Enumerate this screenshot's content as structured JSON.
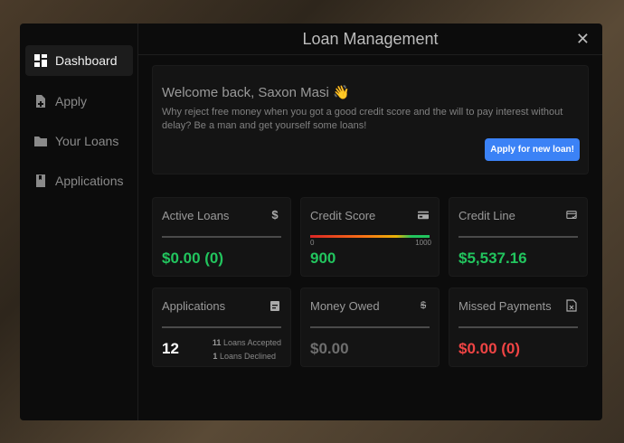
{
  "title": "Loan Management",
  "close": "✕",
  "sidebar": {
    "items": [
      {
        "label": "Dashboard",
        "icon": "dashboard-icon"
      },
      {
        "label": "Apply",
        "icon": "file-plus-icon"
      },
      {
        "label": "Your Loans",
        "icon": "folder-icon"
      },
      {
        "label": "Applications",
        "icon": "book-icon"
      }
    ]
  },
  "welcome": {
    "title": "Welcome back, Saxon Masi 👋",
    "text": "Why reject free money when you got a good credit score and the will to pay interest without delay? Be a man and get yourself some loans!",
    "button": "Apply for new loan!"
  },
  "cards": {
    "active": {
      "title": "Active Loans",
      "value": "$0.00 (0)",
      "icon": "dollar-icon"
    },
    "credit": {
      "title": "Credit Score",
      "value": "900",
      "min": "0",
      "max": "1000",
      "icon": "credit-card-icon"
    },
    "line": {
      "title": "Credit Line",
      "value": "$5,537.16",
      "icon": "card-check-icon"
    },
    "apps": {
      "title": "Applications",
      "value": "12",
      "accepted_n": "11",
      "accepted": "Loans Accepted",
      "declined_n": "1",
      "declined": "Loans Declined",
      "icon": "clipboard-icon"
    },
    "owed": {
      "title": "Money Owed",
      "value": "$0.00",
      "icon": "dollar-off-icon"
    },
    "missed": {
      "title": "Missed Payments",
      "value": "$0.00 (0)",
      "icon": "file-x-icon"
    }
  },
  "colors": {
    "accent": "#3b82f6",
    "positive": "#22c55e",
    "negative": "#ef4444"
  }
}
